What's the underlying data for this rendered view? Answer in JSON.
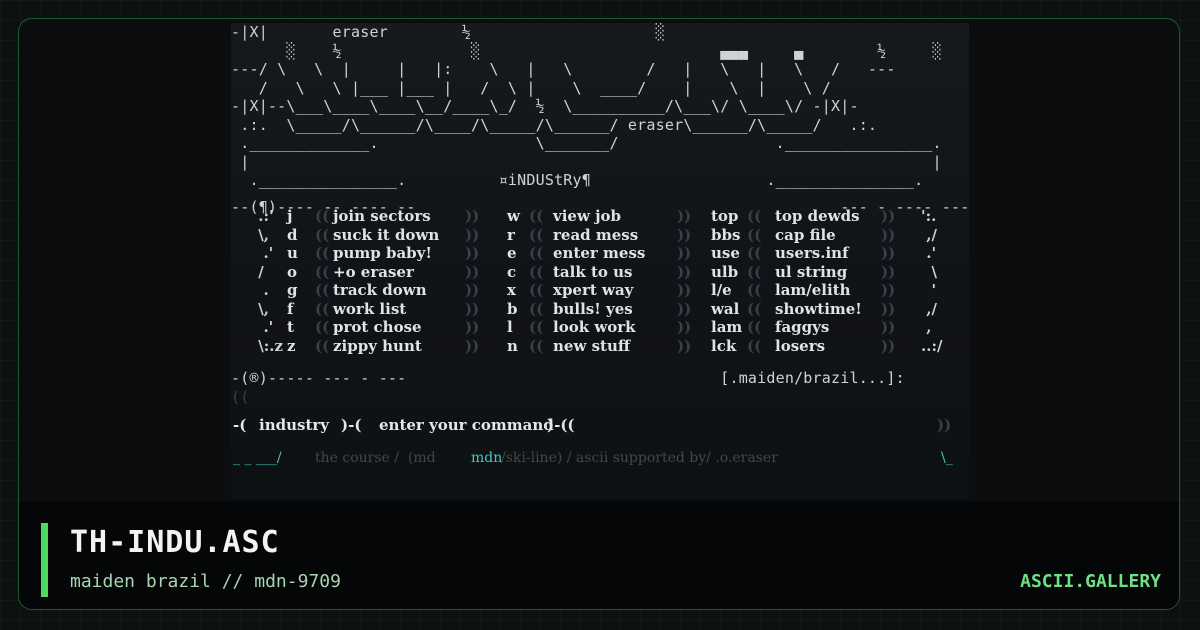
{
  "art": {
    "header": "-|X|       eraser        ½                    ░                                   -|X|-\n      ░    ½              ░                          ▄▄▄     ▄        ½     ░\n---/ \\   \\  |     |   |:    \\   |   \\        /   |   \\   |   \\   /   ---\n   /   \\   \\ |___ |___ |   /  \\ |    \\  ____/    |    \\  |    \\ /\n-|X|--\\___\\____\\____\\__/____\\_/  ½  \\__________/\\___\\/ \\____\\/ -|X|-\n .:.  \\_____/\\______/\\____/\\_____/\\______/ eraser\\______/\\_____/   .:.\n ._____________.                 \\_______/                 .________________.\n |                                                                          |\n  ._______________.          ¤iNDUStRy¶                   ._______________.",
    "divider_top": "--(¶)---- -- ---- --                                              --- - ---- ---(¶)-",
    "divider_bottom": "-(®)----- --- - ---                                  [.maiden/brazil...]:",
    "side_left": [
      " .:'",
      " \\,",
      "  .'",
      " /",
      "  .",
      " \\,",
      "  .'",
      " \\:.z"
    ],
    "side_right": [
      "':.",
      " ,/",
      " .'",
      "  \\",
      "  '",
      " ,/",
      " ,",
      "..:/"
    ]
  },
  "menu": {
    "rows": [
      {
        "k1": "j",
        "l1": "join sectors",
        "k2": "w",
        "l2": "view job",
        "k3": "top",
        "l3": "top dewds"
      },
      {
        "k1": "d",
        "l1": "suck it down",
        "k2": "r",
        "l2": "read mess",
        "k3": "bbs",
        "l3": "cap file"
      },
      {
        "k1": "u",
        "l1": "pump baby!",
        "k2": "e",
        "l2": "enter mess",
        "k3": "use",
        "l3": "users.inf"
      },
      {
        "k1": "o",
        "l1": "+o eraser",
        "k2": "c",
        "l2": "talk to us",
        "k3": "ulb",
        "l3": "ul string"
      },
      {
        "k1": "g",
        "l1": "track down",
        "k2": "x",
        "l2": "xpert way",
        "k3": "l/e",
        "l3": "lam/elith"
      },
      {
        "k1": "f",
        "l1": "work list",
        "k2": "b",
        "l2": "bulls! yes",
        "k3": "wal",
        "l3": "showtime!"
      },
      {
        "k1": "t",
        "l1": "prot chose",
        "k2": "l",
        "l2": "look work",
        "k3": "lam",
        "l3": "faggys"
      },
      {
        "k1": "z",
        "l1": "zippy hunt",
        "k2": "n",
        "l2": "new stuff",
        "k3": "lck",
        "l3": "losers"
      }
    ]
  },
  "command": {
    "prompt_left": "-(",
    "word": "industry",
    "sep": ")-(",
    "text": "enter your command",
    "prompt_right": ")-(("
  },
  "footer_line": {
    "left": "_ _ ___/",
    "mid1": "the course /  (md",
    "cyan": "mdn",
    "mid2": "/ski-line) / ascii supported by/ .o.eraser",
    "right": "\\_"
  },
  "card": {
    "title": "TH-INDU.ASC",
    "subtitle": "maiden brazil // mdn-9709",
    "brand": "ASCII.GALLERY"
  },
  "colors": {
    "accent": "#4cd964",
    "brand": "#6ee085",
    "art_cyan": "#47c6c6"
  }
}
